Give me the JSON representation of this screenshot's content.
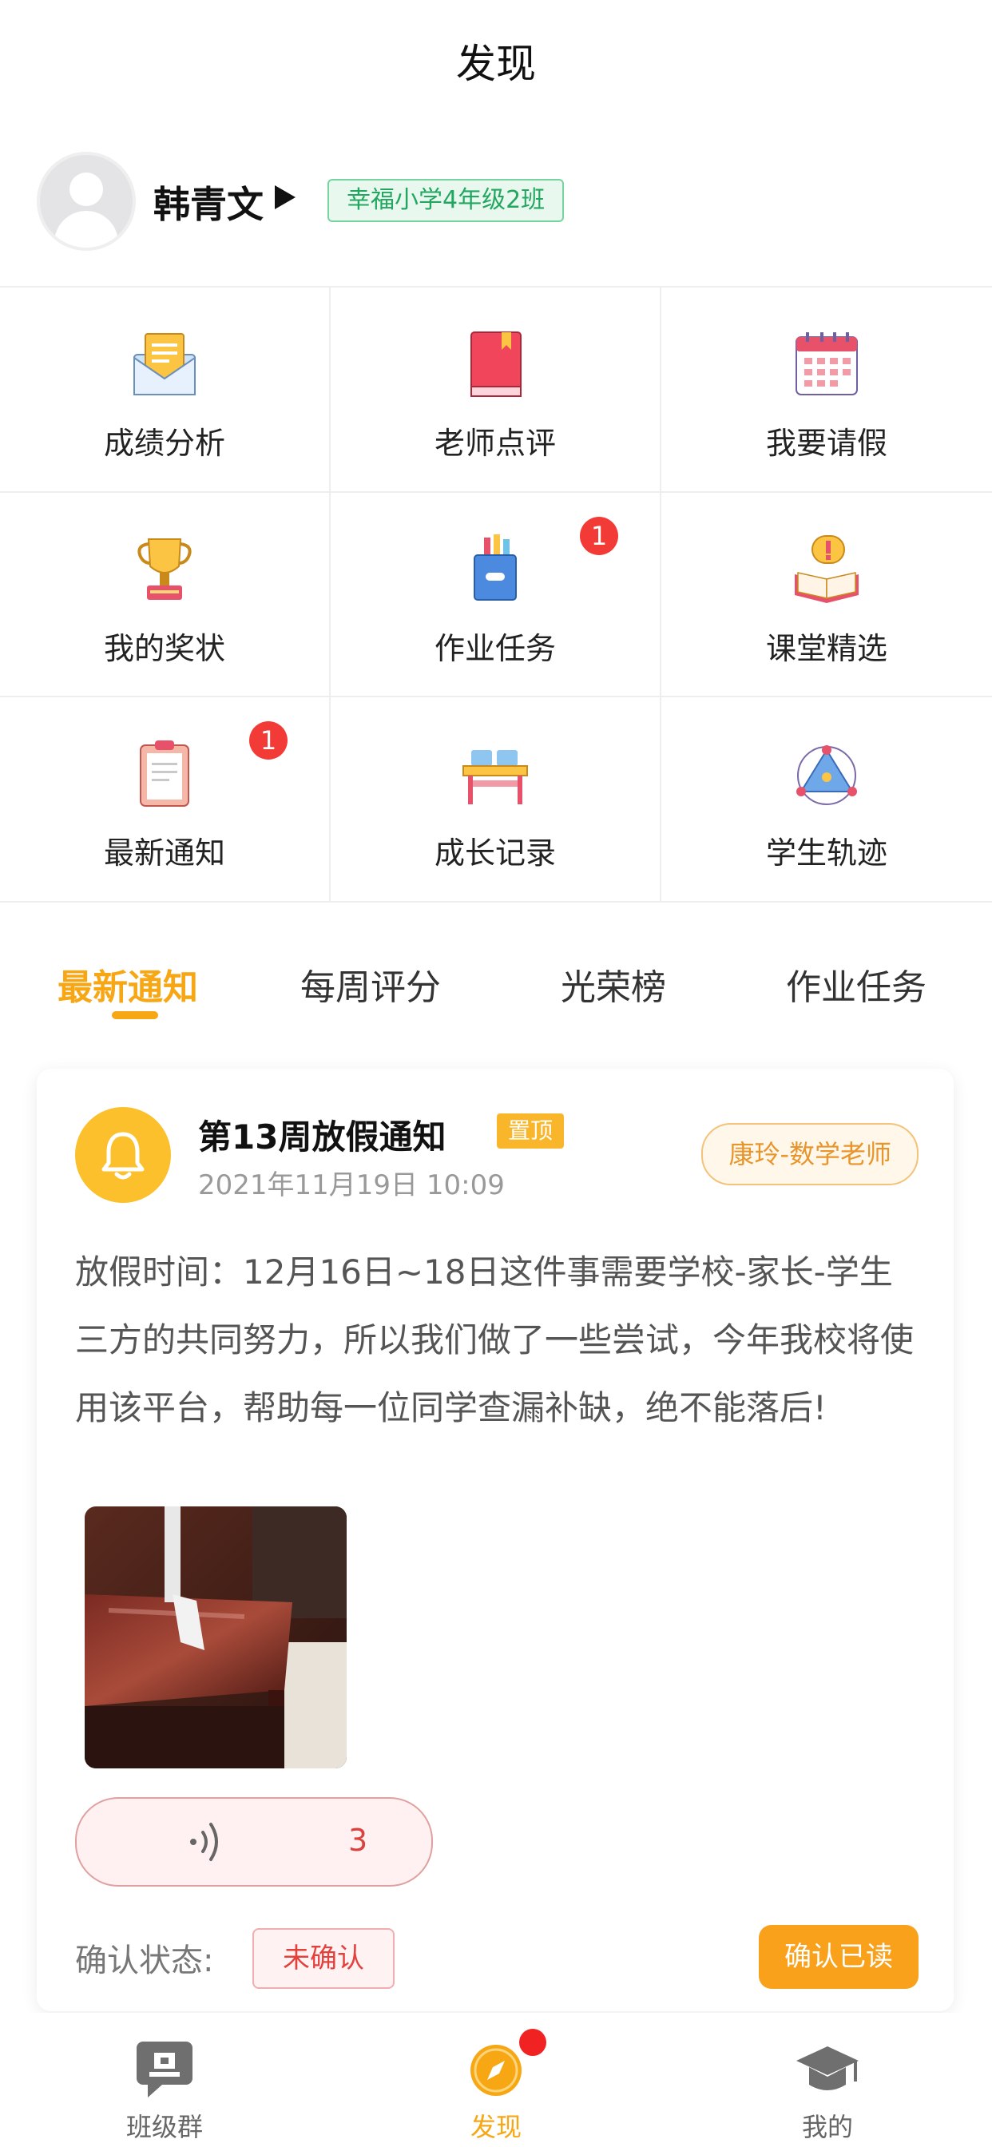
{
  "header": {
    "title": "发现"
  },
  "profile": {
    "name": "韩青文",
    "class": "幸福小学4年级2班"
  },
  "grid": {
    "items": [
      {
        "label": "成绩分析",
        "icon": "report-envelope-icon"
      },
      {
        "label": "老师点评",
        "icon": "red-book-icon"
      },
      {
        "label": "我要请假",
        "icon": "calendar-icon"
      },
      {
        "label": "我的奖状",
        "icon": "trophy-icon"
      },
      {
        "label": "作业任务",
        "icon": "pencil-cup-icon",
        "badge": "1"
      },
      {
        "label": "课堂精选",
        "icon": "book-alert-icon"
      },
      {
        "label": "最新通知",
        "icon": "clipboard-icon",
        "badge": "1"
      },
      {
        "label": "成长记录",
        "icon": "desk-icon"
      },
      {
        "label": "学生轨迹",
        "icon": "network-icon"
      }
    ]
  },
  "tabs": [
    "最新通知",
    "每周评分",
    "光荣榜",
    "作业任务"
  ],
  "notice": {
    "title": "第13周放假通知",
    "pin": "置顶",
    "date": "2021年11月19日 10:09",
    "author": "康玲-数学老师",
    "body": "放假时间：12月16日~18日这件事需要学校-家长-学生三方的共同努力，所以我们做了一些尝试，今年我校将使用该平台，帮助每一位同学查漏补缺，绝不能落后!",
    "audio_count": "3",
    "confirm_label": "确认状态:",
    "status": "未确认",
    "confirm_button": "确认已读"
  },
  "bottom_nav": {
    "items": [
      "班级群",
      "发现",
      "我的"
    ]
  },
  "colors": {
    "accent": "#f7a614",
    "badge_red": "#f23b36",
    "green": "#23a760"
  }
}
